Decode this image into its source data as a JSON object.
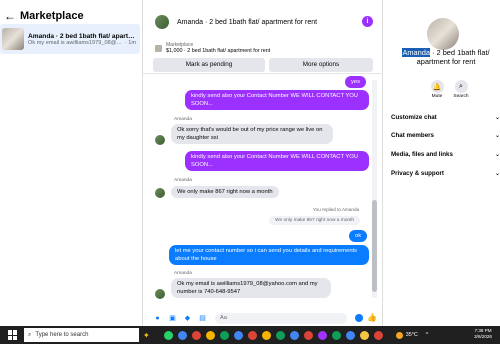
{
  "sidebar": {
    "title": "Marketplace",
    "conversation": {
      "title": "Amanda · 2 bed 1bath flat/ apartment for rent",
      "preview": "Ok my email is awilliams1979_08@ya...",
      "time": "· 1m"
    }
  },
  "chat": {
    "title": "Amanda · 2 bed 1bath flat/ apartment for rent",
    "info_icon": "i",
    "listing": {
      "label": "Marketplace",
      "text": "$1,000 · 2 bed 1bath flat/ apartment for rent"
    },
    "buttons": {
      "pending": "Mark as pending",
      "more": "More options"
    },
    "messages": [
      {
        "text": "yes"
      },
      {
        "text": "kindly send also your Contact Number WE WILL CONTACT YOU SOON..."
      },
      {
        "sender": "Amanda",
        "text": "Ok sorry that's would be out of my price range we live on my daughter ssi"
      },
      {
        "text": "kindly send also your Contact Number WE WILL CONTACT YOU SOON..."
      },
      {
        "sender": "Amanda",
        "text": "We only make 867 right now a month"
      },
      {
        "replied_label": "You replied to Amanda",
        "quoted": "We only make 867 right now a month",
        "text": "ok"
      },
      {
        "text": "let me your contact number so i can send you details and requirements about the house"
      },
      {
        "sender": "Amanda",
        "text": "Ok my email is awilliams1979_08@yahoo.com and my number is 740-648-9547"
      }
    ],
    "composer_placeholder": "Aa"
  },
  "details": {
    "title_highlight": "Amanda",
    "title_rest": " · 2 bed 1bath flat/ apartment for rent",
    "mute_label": "Mute",
    "search_label": "Search",
    "menu": [
      "Customize chat",
      "Chat members",
      "Media, files and links",
      "Privacy & support"
    ]
  },
  "taskbar": {
    "search_placeholder": "Type here to search",
    "temperature": "35°C",
    "time": "7:38 PM",
    "date": "3/6/2026"
  },
  "colors": {
    "outgoing": "#9b30ff",
    "outgoing_blue": "#0a7cff",
    "incoming": "#e4e6eb"
  }
}
